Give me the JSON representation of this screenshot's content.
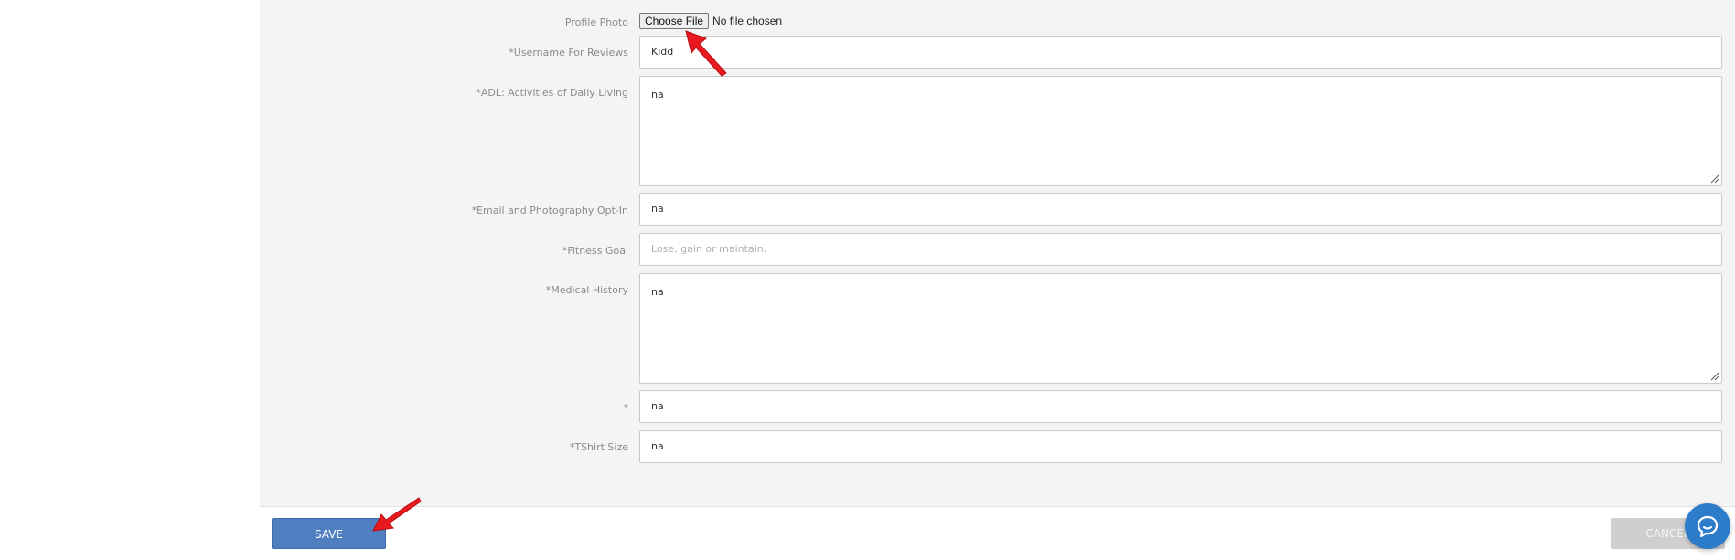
{
  "form": {
    "profile_photo": {
      "label": "Profile Photo",
      "button_label": "Choose File",
      "status": "No file chosen"
    },
    "username": {
      "label": "*Username For Reviews",
      "value": "Kidd"
    },
    "adl": {
      "label": "*ADL: Activities of Daily Living",
      "value": "na"
    },
    "email_photo_optin": {
      "label": "*Email and Photography Opt-In",
      "value": "na"
    },
    "fitness_goal": {
      "label": "*Fitness Goal",
      "value": "",
      "placeholder": "Lose, gain or maintain."
    },
    "medical_history": {
      "label": "*Medical History",
      "value": "na"
    },
    "unnamed_field": {
      "label": "*",
      "value": "na"
    },
    "tshirt_size": {
      "label": "*TShirt Size",
      "value": "na"
    }
  },
  "footer": {
    "save_label": "SAVE",
    "cancel_label": "CANCEL"
  },
  "colors": {
    "save_button": "#4f7fc1",
    "cancel_button": "#cfcfcf",
    "chat_button": "#2d7cc9",
    "annotation_arrow": "#e8191f"
  },
  "icons": {
    "chat": "chat-bubble-icon",
    "annotation": "red-arrow-icon"
  }
}
